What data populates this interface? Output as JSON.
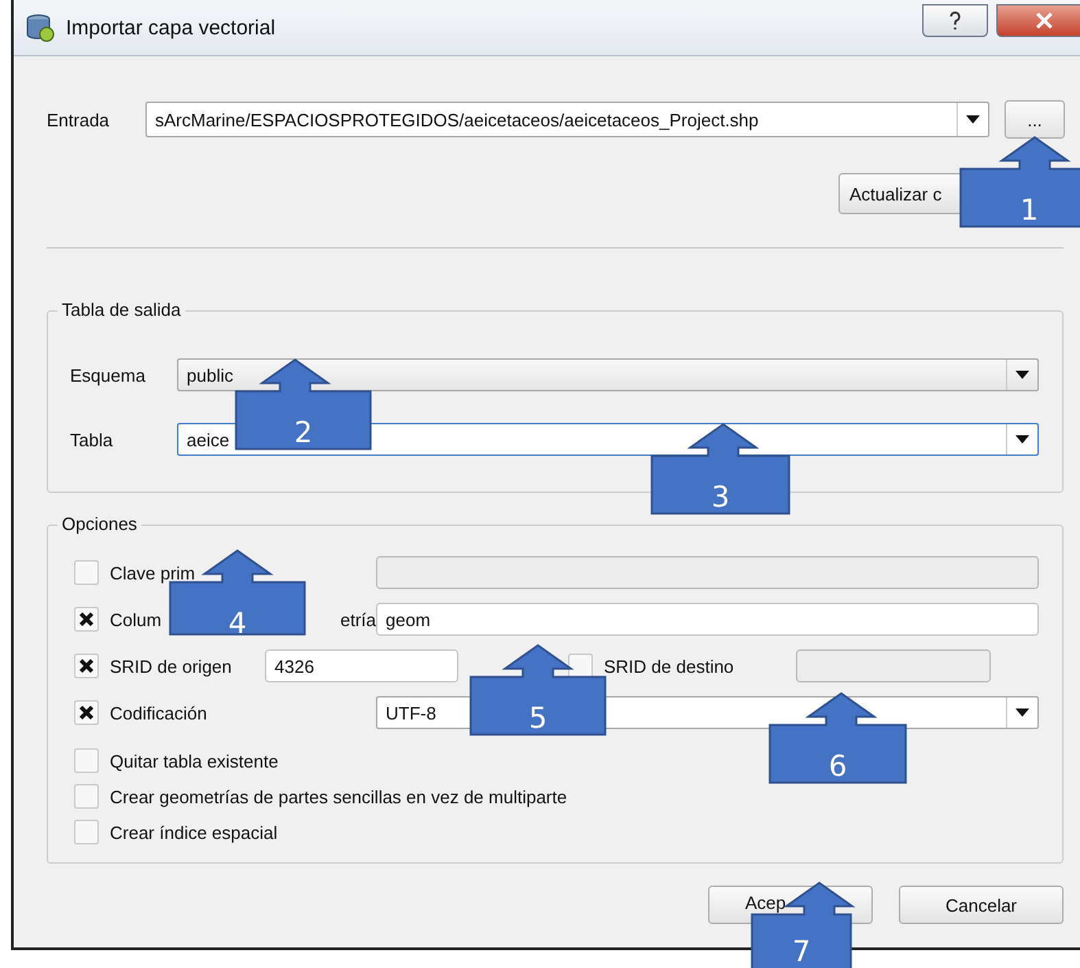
{
  "window": {
    "title": "Importar capa vectorial"
  },
  "input": {
    "label": "Entrada",
    "value": "sArcMarine/ESPACIOSPROTEGIDOS/aeicetaceos/aeicetaceos_Project.shp",
    "browse": "...",
    "refresh": "Actualizar c"
  },
  "output_table": {
    "title": "Tabla de salida",
    "schema": {
      "label": "Esquema",
      "value": "public"
    },
    "table": {
      "label": "Tabla",
      "value": "aeice"
    }
  },
  "options": {
    "title": "Opciones",
    "rows": [
      {
        "kind": "field",
        "label": "Clave prim",
        "checked": false,
        "disabled": true
      },
      {
        "kind": "field",
        "label": "Colum",
        "label_tail": "etría",
        "checked": true,
        "value": "geom",
        "disabled": false
      },
      {
        "kind": "srid",
        "label": "SRID de origen",
        "checked": true,
        "value": "4326",
        "target": {
          "label": "SRID de destino",
          "checked": false,
          "disabled": true
        }
      },
      {
        "kind": "select",
        "label": "Codificación",
        "checked": true,
        "value": "UTF-8"
      },
      {
        "kind": "plain",
        "label": "Quitar tabla existente",
        "checked": false
      },
      {
        "kind": "plain",
        "label": "Crear geometrías de partes sencillas en vez de multiparte",
        "checked": false
      },
      {
        "kind": "plain",
        "label": "Crear índice espacial",
        "checked": false
      }
    ]
  },
  "buttons": [
    {
      "label": "Acep"
    },
    {
      "label": "Cancelar"
    }
  ],
  "callouts": [
    {
      "number": "1"
    },
    {
      "number": "2"
    },
    {
      "number": "3"
    },
    {
      "number": "4"
    },
    {
      "number": "5"
    },
    {
      "number": "6"
    },
    {
      "number": "7"
    }
  ]
}
